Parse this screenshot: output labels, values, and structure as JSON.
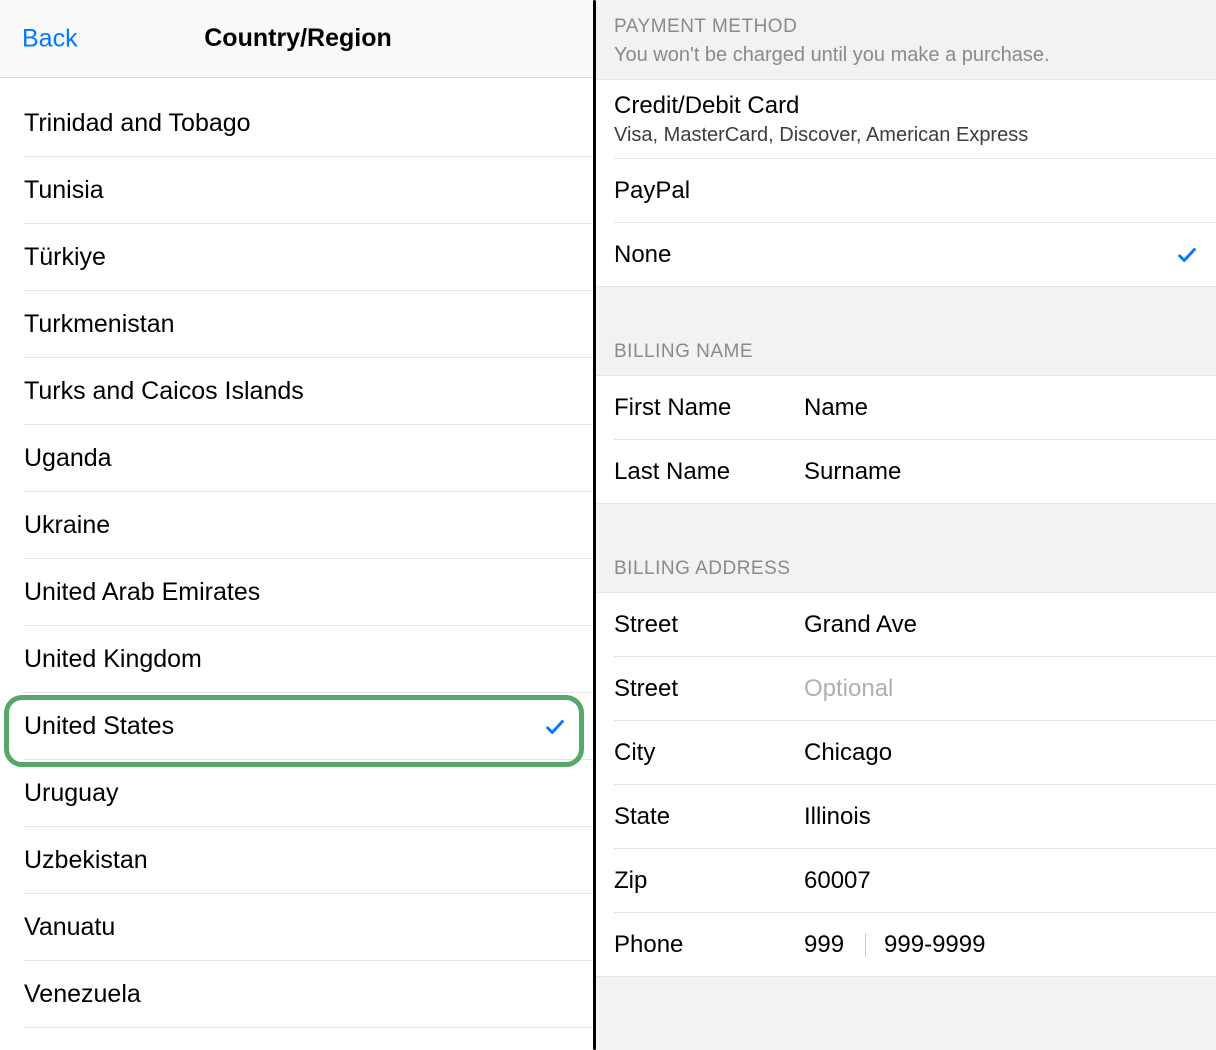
{
  "left": {
    "back": "Back",
    "title": "Country/Region",
    "selected": "United States",
    "countries": [
      "Trinidad and Tobago",
      "Tunisia",
      "Türkiye",
      "Turkmenistan",
      "Turks and Caicos Islands",
      "Uganda",
      "Ukraine",
      "United Arab Emirates",
      "United Kingdom",
      "United States",
      "Uruguay",
      "Uzbekistan",
      "Vanuatu",
      "Venezuela"
    ]
  },
  "right": {
    "paymentMethod": {
      "header": "PAYMENT METHOD",
      "subheader": "You won't be charged until you make a purchase.",
      "selected": "None",
      "options": [
        {
          "title": "Credit/Debit Card",
          "subtitle": "Visa, MasterCard, Discover, American Express"
        },
        {
          "title": "PayPal"
        },
        {
          "title": "None"
        }
      ]
    },
    "billingName": {
      "header": "BILLING NAME",
      "fields": [
        {
          "label": "First Name",
          "value": "Name"
        },
        {
          "label": "Last Name",
          "value": "Surname"
        }
      ]
    },
    "billingAddress": {
      "header": "BILLING ADDRESS",
      "fields": [
        {
          "label": "Street",
          "value": "Grand Ave"
        },
        {
          "label": "Street",
          "value": "",
          "placeholder": "Optional"
        },
        {
          "label": "City",
          "value": "Chicago"
        },
        {
          "label": "State",
          "value": "Illinois"
        },
        {
          "label": "Zip",
          "value": "60007"
        }
      ],
      "phone": {
        "label": "Phone",
        "prefix": "999",
        "number": "999-9999"
      }
    }
  }
}
